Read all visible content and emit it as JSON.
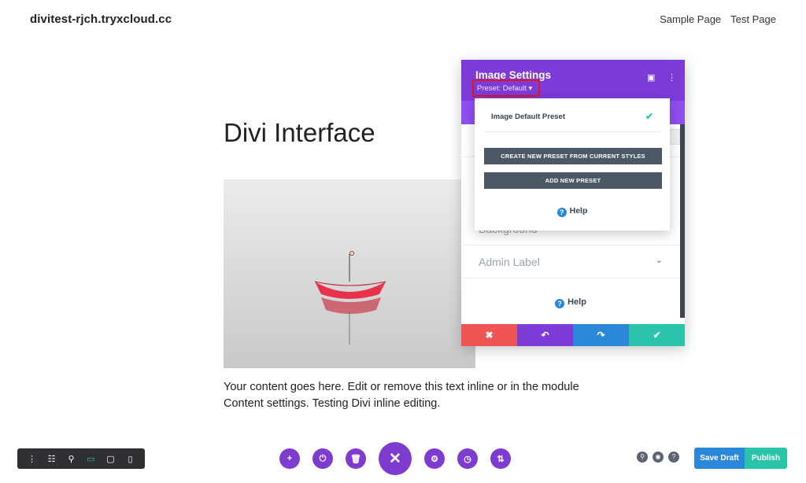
{
  "site": {
    "title": "divitest-rjch.tryxcloud.cc",
    "nav": [
      "Sample Page",
      "Test Page"
    ]
  },
  "content": {
    "heading": "Divi Interface",
    "image_alt": "Red umbrella floating on water",
    "paragraph": "Your content goes here. Edit or remove this text inline or in the module Content settings. Testing Divi inline editing."
  },
  "modal": {
    "title": "Image Settings",
    "preset_label": "Preset: Default ▾",
    "sections": [
      "Background",
      "Admin Label"
    ],
    "help": "Help",
    "footer": [
      "✖",
      "↶",
      "↷",
      "✔"
    ]
  },
  "dropdown": {
    "item": "Image Default Preset",
    "create_btn": "CREATE NEW PRESET FROM CURRENT STYLES",
    "add_btn": "ADD NEW PRESET",
    "help": "Help"
  },
  "toolbar": {
    "left_icons": [
      "⋮",
      "☷",
      "⚲",
      "▭",
      "▢",
      "▯"
    ],
    "center_icons": [
      "+",
      "⏻",
      "🗑",
      "✕",
      "⚙",
      "◷",
      "⇅"
    ],
    "right_icons": [
      "⚲",
      "◉",
      "?"
    ],
    "save_draft": "Save Draft",
    "publish": "Publish"
  },
  "colors": {
    "purple": "#7d3bd8",
    "teal": "#29c4a9",
    "blue": "#2b87da",
    "red": "#ef5555",
    "dark": "#2e3033"
  }
}
